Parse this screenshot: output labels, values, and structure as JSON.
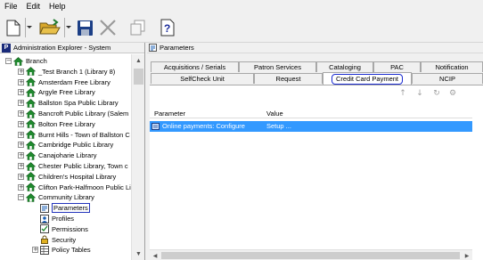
{
  "menu": [
    "File",
    "Edit",
    "Help"
  ],
  "toolbar": {
    "icons": [
      "new-document-icon",
      "open-folder-icon",
      "save-icon",
      "delete-icon",
      "copy-icon",
      "find-icon"
    ]
  },
  "left_panel": {
    "title": "Administration Explorer - System",
    "tree": {
      "root": "Branch",
      "branches": [
        "_Test Branch 1 (Library 8)",
        "Amsterdam Free Library",
        "Argyle Free Library",
        "Ballston Spa Public Library",
        "Bancroft Public Library (Salem",
        "Bolton Free Library",
        "Burnt Hills - Town of Ballston C",
        "Cambridge Public Library",
        "Canajoharie Library",
        "Chester Public Library, Town c",
        "Children's Hospital Library",
        "Clifton Park-Halfmoon Public Lib",
        "Community Library"
      ],
      "children": [
        "Parameters",
        "Profiles",
        "Permissions",
        "Security",
        "Policy Tables"
      ]
    }
  },
  "right_panel": {
    "title": "Parameters",
    "tabs_row1": [
      "Acquisitions / Serials",
      "Patron Services",
      "Cataloging",
      "PAC",
      "Notification"
    ],
    "tabs_row2": [
      "SelfCheck Unit",
      "Request",
      "Credit Card Payment",
      "NCIP"
    ],
    "active_tab": "Credit Card Payment",
    "grid": {
      "columns": [
        "Parameter",
        "Value"
      ],
      "rows": [
        {
          "parameter": "Online payments: Configure",
          "value": "Setup ..."
        }
      ]
    }
  },
  "colors": {
    "selection": "#3399ff",
    "highlight_outline": "#1a2bd0",
    "house_green": "#1f8a2e"
  }
}
